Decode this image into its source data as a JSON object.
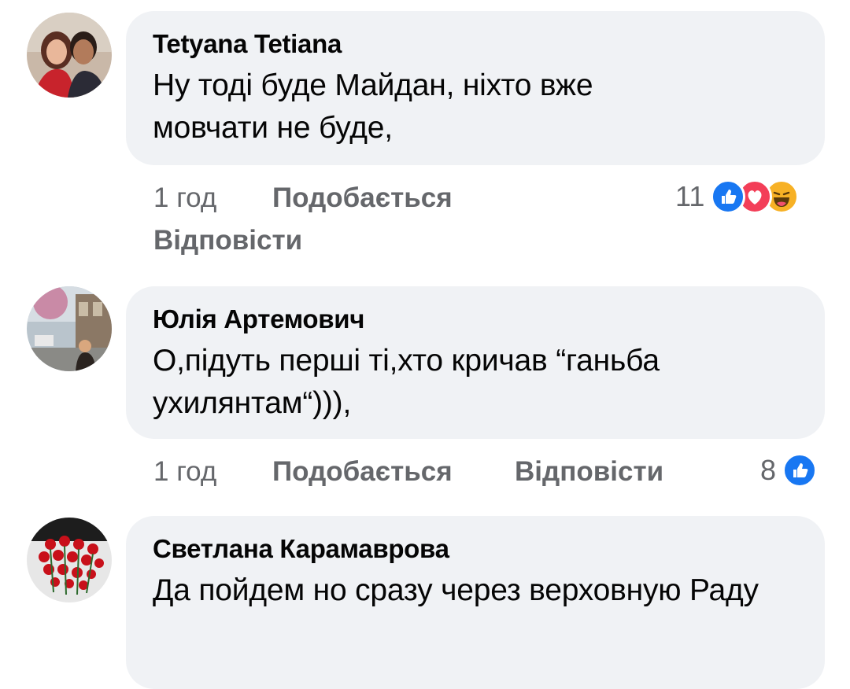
{
  "comments": [
    {
      "author": "Tetyana Tetiana",
      "text": "Ну тоді буде Майдан, ніхто вже мовчати не буде,",
      "time": "1 год",
      "like_label": "Подобається",
      "reply_label": "Відповісти",
      "reaction_count": "11",
      "reactions": [
        "like-icon",
        "love-icon",
        "haha-icon"
      ]
    },
    {
      "author": "Юлія Артемович",
      "text": "О,підуть перші ті,хто кричав “ганьба ухилянтам“))),",
      "time": "1 год",
      "like_label": "Подобається",
      "reply_label": "Відповісти",
      "reaction_count": "8",
      "reactions": [
        "like-icon"
      ]
    },
    {
      "author": "Светлана Карамаврова",
      "text": "Да пойдем но сразу через верховную Раду"
    }
  ],
  "colors": {
    "bubble": "#f0f2f5",
    "meta_text": "#65676b",
    "like_blue": "#1877f2",
    "love_red": "#f33e58",
    "haha_yellow": "#f7b125"
  }
}
